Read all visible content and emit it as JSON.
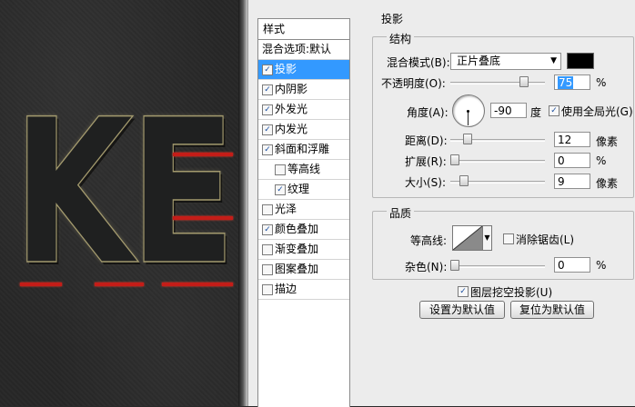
{
  "canvas": {
    "text": "KE",
    "accent": "#c41d18",
    "outline": "#a39a6e"
  },
  "styles_panel": {
    "header": "样式",
    "blending": "混合选项:默认",
    "items": [
      {
        "label": "投影",
        "checked": true,
        "selected": true,
        "indent": false
      },
      {
        "label": "内阴影",
        "checked": true,
        "selected": false,
        "indent": false
      },
      {
        "label": "外发光",
        "checked": true,
        "selected": false,
        "indent": false
      },
      {
        "label": "内发光",
        "checked": true,
        "selected": false,
        "indent": false
      },
      {
        "label": "斜面和浮雕",
        "checked": true,
        "selected": false,
        "indent": false
      },
      {
        "label": "等高线",
        "checked": false,
        "selected": false,
        "indent": true
      },
      {
        "label": "纹理",
        "checked": true,
        "selected": false,
        "indent": true
      },
      {
        "label": "光泽",
        "checked": false,
        "selected": false,
        "indent": false
      },
      {
        "label": "颜色叠加",
        "checked": true,
        "selected": false,
        "indent": false
      },
      {
        "label": "渐变叠加",
        "checked": false,
        "selected": false,
        "indent": false
      },
      {
        "label": "图案叠加",
        "checked": false,
        "selected": false,
        "indent": false
      },
      {
        "label": "描边",
        "checked": false,
        "selected": false,
        "indent": false
      }
    ]
  },
  "shadow": {
    "title": "投影",
    "structure": "结构",
    "blend_mode_label": "混合模式(B):",
    "blend_mode_value": "正片叠底",
    "blend_color": "#000000",
    "opacity_label": "不透明度(O):",
    "opacity_value": "75",
    "opacity_unit": "%",
    "angle_label": "角度(A):",
    "angle_value": "-90",
    "angle_unit": "度",
    "global_light_label": "使用全局光(G)",
    "global_light_checked": true,
    "distance_label": "距离(D):",
    "distance_value": "12",
    "distance_unit": "像素",
    "spread_label": "扩展(R):",
    "spread_value": "0",
    "spread_unit": "%",
    "size_label": "大小(S):",
    "size_value": "9",
    "size_unit": "像素",
    "quality": "品质",
    "contour_label": "等高线:",
    "antialias_label": "消除锯齿(L)",
    "antialias_checked": false,
    "noise_label": "杂色(N):",
    "noise_value": "0",
    "noise_unit": "%",
    "knockout_label": "图层挖空投影(U)",
    "knockout_checked": true,
    "set_default": "设置为默认值",
    "reset_default": "复位为默认值"
  }
}
